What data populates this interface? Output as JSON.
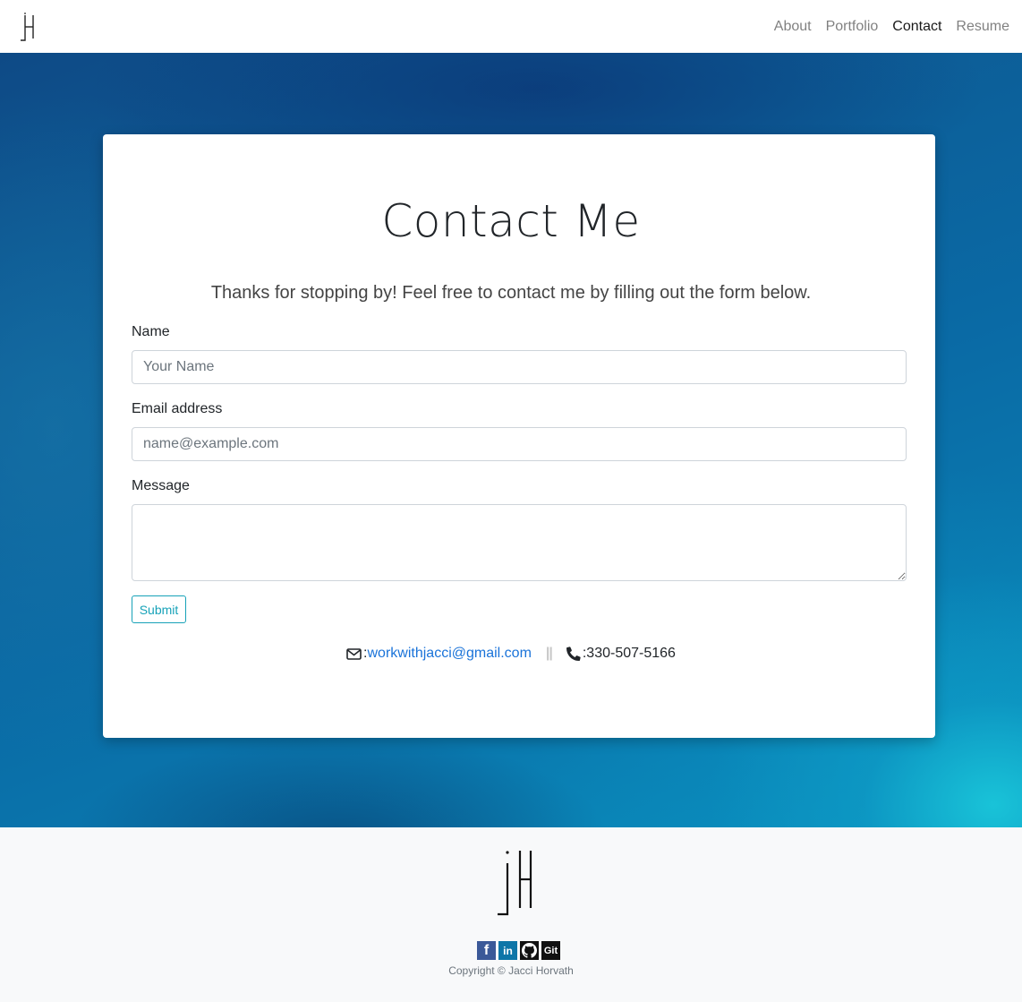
{
  "nav": {
    "brand": "jH",
    "links": [
      {
        "label": "About"
      },
      {
        "label": "Portfolio"
      },
      {
        "label": "Contact"
      },
      {
        "label": "Resume"
      }
    ]
  },
  "contact": {
    "title": "Contact Me",
    "lead": "Thanks for stopping by! Feel free to contact me by filling out the form below.",
    "name_label": "Name",
    "name_placeholder": "Your Name",
    "email_label": "Email address",
    "email_placeholder": "name@example.com",
    "message_label": "Message",
    "message_value": "",
    "submit_label": "Submit",
    "email_prefix": ": ",
    "email": "workwithjacci@gmail.com",
    "separator": "||",
    "phone_prefix": ": ",
    "phone": "330-507-5166"
  },
  "footer": {
    "social": [
      {
        "name": "facebook",
        "glyph": "f",
        "color": "#3b5998"
      },
      {
        "name": "linkedin",
        "glyph": "in",
        "color": "#0e76a8"
      },
      {
        "name": "github",
        "glyph": "",
        "color": "#111111"
      },
      {
        "name": "git",
        "glyph": "Git",
        "color": "#111111"
      }
    ],
    "copyright": "Copyright © Jacci Horvath"
  }
}
